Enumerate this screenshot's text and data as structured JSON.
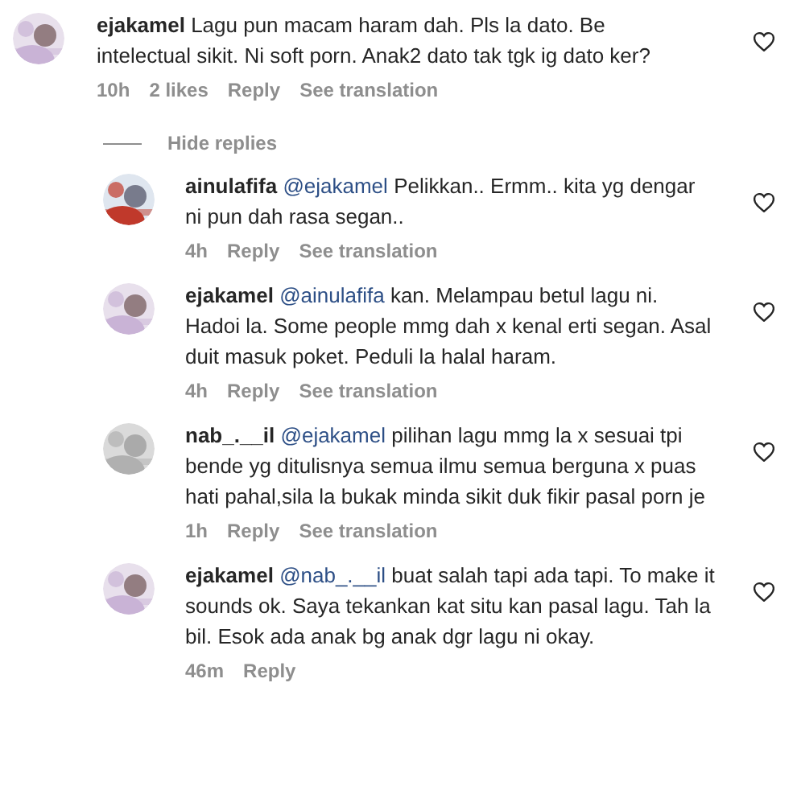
{
  "comment": {
    "username": "ejakamel",
    "text": "Lagu pun macam haram dah. Pls la dato. Be intelectual sikit. Ni soft porn. Anak2 dato tak tgk ig dato ker?",
    "liked": false,
    "time": "10h",
    "likes": "2 likes",
    "reply": "Reply",
    "translate": "See translation"
  },
  "toggle": {
    "label": "Hide replies"
  },
  "replies": [
    {
      "username": "ainulafifa",
      "mention": "@ejakamel",
      "text": "Pelikkan.. Ermm.. kita yg dengar ni pun dah rasa segan..",
      "liked": false,
      "time": "4h",
      "reply": "Reply",
      "translate": "See translation"
    },
    {
      "username": "ejakamel",
      "mention": "@ainulafifa",
      "text": "kan. Melampau betul lagu ni. Hadoi la. Some people mmg dah x kenal erti segan. Asal duit masuk poket. Peduli la halal haram.",
      "liked": false,
      "time": "4h",
      "reply": "Reply",
      "translate": "See translation"
    },
    {
      "username": "nab_.__il",
      "mention": "@ejakamel",
      "text": "pilihan lagu mmg la x sesuai tpi bende yg ditulisnya semua ilmu semua berguna x puas hati pahal,sila la bukak minda sikit duk fikir pasal porn je",
      "liked": false,
      "time": "1h",
      "reply": "Reply",
      "translate": "See translation"
    },
    {
      "username": "ejakamel",
      "mention": "@nab_.__il",
      "text": "buat salah tapi ada tapi. To make it sounds ok. Saya tekankan kat situ kan pasal lagu. Tah la bil. Esok ada anak bg anak dgr lagu ni okay.",
      "liked": false,
      "time": "46m",
      "reply": "Reply"
    }
  ]
}
